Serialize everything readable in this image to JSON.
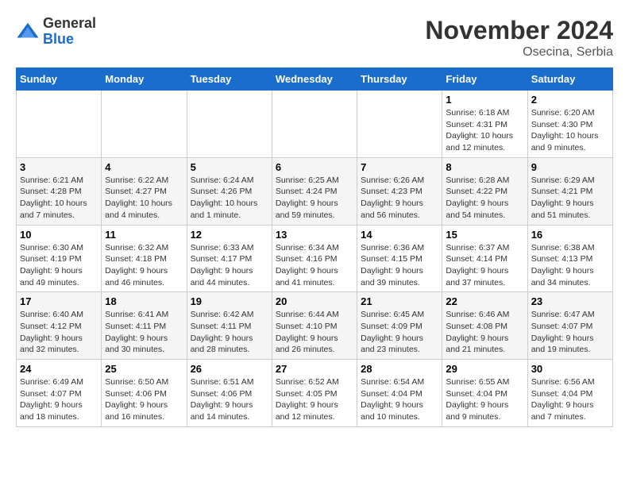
{
  "header": {
    "logo": {
      "general": "General",
      "blue": "Blue"
    },
    "title": "November 2024",
    "location": "Osecina, Serbia"
  },
  "weekdays": [
    "Sunday",
    "Monday",
    "Tuesday",
    "Wednesday",
    "Thursday",
    "Friday",
    "Saturday"
  ],
  "weeks": [
    [
      {
        "day": "",
        "info": ""
      },
      {
        "day": "",
        "info": ""
      },
      {
        "day": "",
        "info": ""
      },
      {
        "day": "",
        "info": ""
      },
      {
        "day": "",
        "info": ""
      },
      {
        "day": "1",
        "info": "Sunrise: 6:18 AM\nSunset: 4:31 PM\nDaylight: 10 hours\nand 12 minutes."
      },
      {
        "day": "2",
        "info": "Sunrise: 6:20 AM\nSunset: 4:30 PM\nDaylight: 10 hours\nand 9 minutes."
      }
    ],
    [
      {
        "day": "3",
        "info": "Sunrise: 6:21 AM\nSunset: 4:28 PM\nDaylight: 10 hours\nand 7 minutes."
      },
      {
        "day": "4",
        "info": "Sunrise: 6:22 AM\nSunset: 4:27 PM\nDaylight: 10 hours\nand 4 minutes."
      },
      {
        "day": "5",
        "info": "Sunrise: 6:24 AM\nSunset: 4:26 PM\nDaylight: 10 hours\nand 1 minute."
      },
      {
        "day": "6",
        "info": "Sunrise: 6:25 AM\nSunset: 4:24 PM\nDaylight: 9 hours\nand 59 minutes."
      },
      {
        "day": "7",
        "info": "Sunrise: 6:26 AM\nSunset: 4:23 PM\nDaylight: 9 hours\nand 56 minutes."
      },
      {
        "day": "8",
        "info": "Sunrise: 6:28 AM\nSunset: 4:22 PM\nDaylight: 9 hours\nand 54 minutes."
      },
      {
        "day": "9",
        "info": "Sunrise: 6:29 AM\nSunset: 4:21 PM\nDaylight: 9 hours\nand 51 minutes."
      }
    ],
    [
      {
        "day": "10",
        "info": "Sunrise: 6:30 AM\nSunset: 4:19 PM\nDaylight: 9 hours\nand 49 minutes."
      },
      {
        "day": "11",
        "info": "Sunrise: 6:32 AM\nSunset: 4:18 PM\nDaylight: 9 hours\nand 46 minutes."
      },
      {
        "day": "12",
        "info": "Sunrise: 6:33 AM\nSunset: 4:17 PM\nDaylight: 9 hours\nand 44 minutes."
      },
      {
        "day": "13",
        "info": "Sunrise: 6:34 AM\nSunset: 4:16 PM\nDaylight: 9 hours\nand 41 minutes."
      },
      {
        "day": "14",
        "info": "Sunrise: 6:36 AM\nSunset: 4:15 PM\nDaylight: 9 hours\nand 39 minutes."
      },
      {
        "day": "15",
        "info": "Sunrise: 6:37 AM\nSunset: 4:14 PM\nDaylight: 9 hours\nand 37 minutes."
      },
      {
        "day": "16",
        "info": "Sunrise: 6:38 AM\nSunset: 4:13 PM\nDaylight: 9 hours\nand 34 minutes."
      }
    ],
    [
      {
        "day": "17",
        "info": "Sunrise: 6:40 AM\nSunset: 4:12 PM\nDaylight: 9 hours\nand 32 minutes."
      },
      {
        "day": "18",
        "info": "Sunrise: 6:41 AM\nSunset: 4:11 PM\nDaylight: 9 hours\nand 30 minutes."
      },
      {
        "day": "19",
        "info": "Sunrise: 6:42 AM\nSunset: 4:11 PM\nDaylight: 9 hours\nand 28 minutes."
      },
      {
        "day": "20",
        "info": "Sunrise: 6:44 AM\nSunset: 4:10 PM\nDaylight: 9 hours\nand 26 minutes."
      },
      {
        "day": "21",
        "info": "Sunrise: 6:45 AM\nSunset: 4:09 PM\nDaylight: 9 hours\nand 23 minutes."
      },
      {
        "day": "22",
        "info": "Sunrise: 6:46 AM\nSunset: 4:08 PM\nDaylight: 9 hours\nand 21 minutes."
      },
      {
        "day": "23",
        "info": "Sunrise: 6:47 AM\nSunset: 4:07 PM\nDaylight: 9 hours\nand 19 minutes."
      }
    ],
    [
      {
        "day": "24",
        "info": "Sunrise: 6:49 AM\nSunset: 4:07 PM\nDaylight: 9 hours\nand 18 minutes."
      },
      {
        "day": "25",
        "info": "Sunrise: 6:50 AM\nSunset: 4:06 PM\nDaylight: 9 hours\nand 16 minutes."
      },
      {
        "day": "26",
        "info": "Sunrise: 6:51 AM\nSunset: 4:06 PM\nDaylight: 9 hours\nand 14 minutes."
      },
      {
        "day": "27",
        "info": "Sunrise: 6:52 AM\nSunset: 4:05 PM\nDaylight: 9 hours\nand 12 minutes."
      },
      {
        "day": "28",
        "info": "Sunrise: 6:54 AM\nSunset: 4:04 PM\nDaylight: 9 hours\nand 10 minutes."
      },
      {
        "day": "29",
        "info": "Sunrise: 6:55 AM\nSunset: 4:04 PM\nDaylight: 9 hours\nand 9 minutes."
      },
      {
        "day": "30",
        "info": "Sunrise: 6:56 AM\nSunset: 4:04 PM\nDaylight: 9 hours\nand 7 minutes."
      }
    ]
  ]
}
